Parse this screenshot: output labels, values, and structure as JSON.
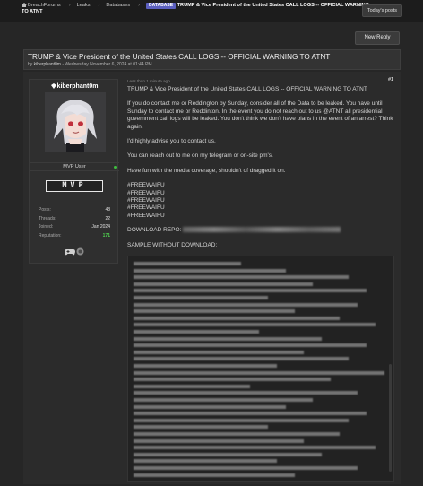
{
  "breadcrumb": {
    "items": [
      "BreachForums",
      "Leaks",
      "Databases"
    ],
    "badge": "DATABASE",
    "title": "TRUMP & Vice President of the United States CALL LOGS -- OFFICIAL WARNING TO ATNT"
  },
  "header": {
    "todays_posts": "Today's posts",
    "new_reply": "New Reply"
  },
  "thread": {
    "title": "TRUMP & Vice President of the United States CALL LOGS -- OFFICIAL WARNING TO ATNT",
    "meta_prefix": "by ",
    "author": "kiberphant0m",
    "meta_suffix": " - Wednesday November 6, 2024 at 01:44 PM"
  },
  "user": {
    "name": "kiberphant0m",
    "group": "MVP User",
    "rank_badge": "MVP",
    "stats": [
      {
        "label": "Posts:",
        "value": "48"
      },
      {
        "label": "Threads:",
        "value": "22"
      },
      {
        "label": "Joined:",
        "value": "Jan 2024"
      },
      {
        "label": "Reputation:",
        "value": "171"
      }
    ],
    "icons": [
      "gamepad-icon",
      "badge-icon"
    ],
    "colors": {
      "reputation": "#4fd14f",
      "online": "#3fbf3f"
    }
  },
  "post": {
    "meta": "Less than 1 minute ago",
    "number": "#1",
    "heading": "TRUMP & Vice President of the United States CALL LOGS -- OFFICIAL WARNING TO ATNT",
    "para1": "If you do contact me or Reddington by Sunday, consider all of the Data to be leaked. You have until Sunday to contact me or Reddinton. In the event you do not reach out to us @ATNT all presidential government call logs will be leaked. You don't think we don't have plans in the event of an arrest? Think again.",
    "para2": "I'd highly advise you to contact us.",
    "para3": "You can reach out to me on my telegram or on-site pm's.",
    "para4": "Have fun with the media coverage, shouldn't of dragged it on.",
    "hashtags": [
      "#FREEWAIFU",
      "#FREEWAIFU",
      "#FREEWAIFU",
      "#FREEWAIFU",
      "#FREEWAIFU"
    ],
    "download_label": "DOWNLOAD REPO:",
    "sample_label": "SAMPLE WITHOUT DOWNLOAD:"
  },
  "accent_colors": {
    "badge": "#5b5fbf",
    "background": "#262626"
  }
}
